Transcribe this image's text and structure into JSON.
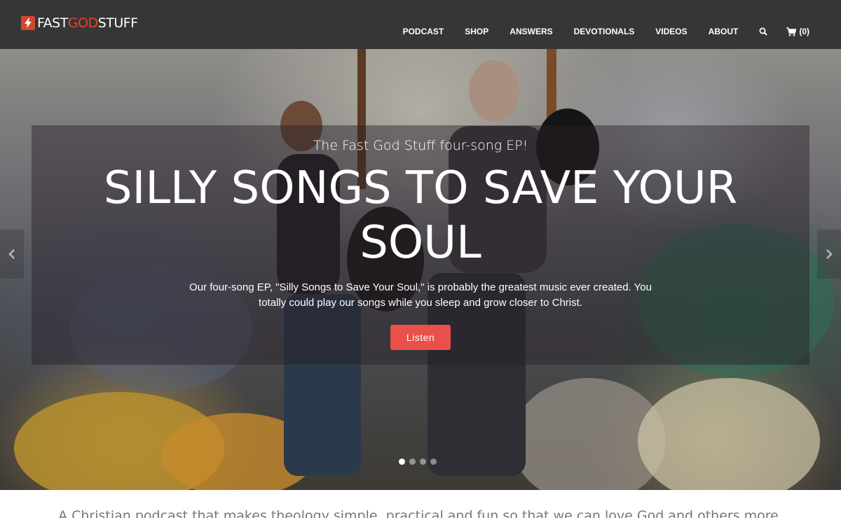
{
  "brand": {
    "name_part1": "FAST",
    "name_part2": "GOD",
    "name_part3": "STUFF",
    "logo_icon": "lightning-bolt-icon",
    "accent_color": "#e2452e"
  },
  "nav": {
    "items": [
      {
        "label": "PODCAST"
      },
      {
        "label": "SHOP"
      },
      {
        "label": "ANSWERS"
      },
      {
        "label": "DEVOTIONALS"
      },
      {
        "label": "VIDEOS"
      },
      {
        "label": "ABOUT"
      }
    ],
    "search_icon": "search-icon",
    "cart_icon": "shopping-cart-icon",
    "cart_count": "(0)"
  },
  "hero": {
    "kicker": "The Fast God Stuff four-song EP!",
    "title": "SILLY SONGS TO SAVE YOUR SOUL",
    "description": "Our four-song EP, \"Silly Songs to Save Your Soul,\" is probably the greatest music ever created. You totally could play our songs while you sleep and grow closer to Christ.",
    "cta_label": "Listen",
    "cta_color": "#e9504a",
    "prev_icon": "chevron-left-icon",
    "next_icon": "chevron-right-icon",
    "slides_total": 4,
    "active_slide": 1
  },
  "tagline": "A Christian podcast that makes theology simple, practical and fun so that we can love God and others more."
}
